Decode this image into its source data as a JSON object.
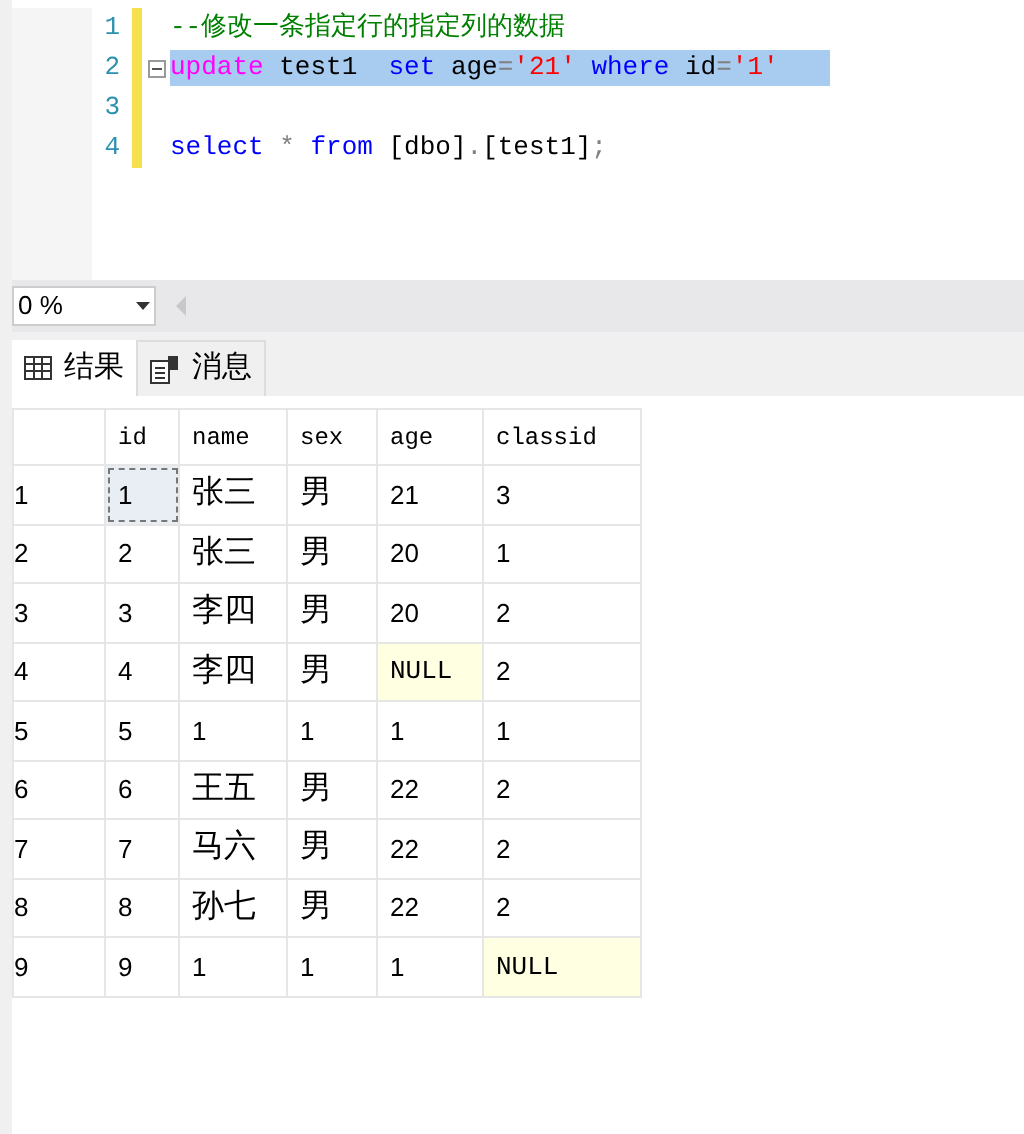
{
  "editor": {
    "lines": [
      {
        "number": "1",
        "selected": false,
        "fold": false,
        "tokens": [
          {
            "kind": "comment",
            "text": "--修改一条指定行的指定列的数据"
          }
        ]
      },
      {
        "number": "2",
        "selected": true,
        "fold": true,
        "tokens": [
          {
            "kind": "function",
            "text": "update"
          },
          {
            "kind": "plain",
            "text": " test1  "
          },
          {
            "kind": "keyword",
            "text": "set"
          },
          {
            "kind": "plain",
            "text": " age"
          },
          {
            "kind": "operator",
            "text": "="
          },
          {
            "kind": "string",
            "text": "'21'"
          },
          {
            "kind": "keyword",
            "text": " where"
          },
          {
            "kind": "plain",
            "text": " id"
          },
          {
            "kind": "operator",
            "text": "="
          },
          {
            "kind": "string",
            "text": "'1'"
          }
        ]
      },
      {
        "number": "3",
        "selected": false,
        "fold": false
      },
      {
        "number": "4",
        "selected": false,
        "fold": false,
        "tokens": [
          {
            "kind": "keyword",
            "text": "select"
          },
          {
            "kind": "operator",
            "text": " *"
          },
          {
            "kind": "keyword",
            "text": " from"
          },
          {
            "kind": "plain",
            "text": " [dbo]"
          },
          {
            "kind": "operator",
            "text": "."
          },
          {
            "kind": "plain",
            "text": "[test1]"
          },
          {
            "kind": "operator",
            "text": ";"
          }
        ]
      }
    ]
  },
  "zoom": {
    "value": "0 %"
  },
  "tabs": [
    {
      "label": "结果",
      "kind": "grid",
      "selected": true
    },
    {
      "label": "消息",
      "kind": "messages",
      "selected": false
    }
  ],
  "table": {
    "columns": [
      "id",
      "name",
      "sex",
      "age",
      "classid"
    ],
    "rows": [
      {
        "number": "1",
        "cells": [
          {
            "text": "1",
            "null": false,
            "focused": true
          },
          {
            "text": "张三",
            "null": false,
            "focused": false
          },
          {
            "text": "男",
            "null": false,
            "focused": false
          },
          {
            "text": "21",
            "null": false,
            "focused": false
          },
          {
            "text": "3",
            "null": false,
            "focused": false
          }
        ]
      },
      {
        "number": "2",
        "cells": [
          {
            "text": "2",
            "null": false,
            "focused": false
          },
          {
            "text": "张三",
            "null": false,
            "focused": false
          },
          {
            "text": "男",
            "null": false,
            "focused": false
          },
          {
            "text": "20",
            "null": false,
            "focused": false
          },
          {
            "text": "1",
            "null": false,
            "focused": false
          }
        ]
      },
      {
        "number": "3",
        "cells": [
          {
            "text": "3",
            "null": false,
            "focused": false
          },
          {
            "text": "李四",
            "null": false,
            "focused": false
          },
          {
            "text": "男",
            "null": false,
            "focused": false
          },
          {
            "text": "20",
            "null": false,
            "focused": false
          },
          {
            "text": "2",
            "null": false,
            "focused": false
          }
        ]
      },
      {
        "number": "4",
        "cells": [
          {
            "text": "4",
            "null": false,
            "focused": false
          },
          {
            "text": "李四",
            "null": false,
            "focused": false
          },
          {
            "text": "男",
            "null": false,
            "focused": false
          },
          {
            "text": "NULL",
            "null": true,
            "focused": false
          },
          {
            "text": "2",
            "null": false,
            "focused": false
          }
        ]
      },
      {
        "number": "5",
        "cells": [
          {
            "text": "5",
            "null": false,
            "focused": false
          },
          {
            "text": "1",
            "null": false,
            "focused": false
          },
          {
            "text": "1",
            "null": false,
            "focused": false
          },
          {
            "text": "1",
            "null": false,
            "focused": false
          },
          {
            "text": "1",
            "null": false,
            "focused": false
          }
        ]
      },
      {
        "number": "6",
        "cells": [
          {
            "text": "6",
            "null": false,
            "focused": false
          },
          {
            "text": "王五",
            "null": false,
            "focused": false
          },
          {
            "text": "男",
            "null": false,
            "focused": false
          },
          {
            "text": "22",
            "null": false,
            "focused": false
          },
          {
            "text": "2",
            "null": false,
            "focused": false
          }
        ]
      },
      {
        "number": "7",
        "cells": [
          {
            "text": "7",
            "null": false,
            "focused": false
          },
          {
            "text": "马六",
            "null": false,
            "focused": false
          },
          {
            "text": "男",
            "null": false,
            "focused": false
          },
          {
            "text": "22",
            "null": false,
            "focused": false
          },
          {
            "text": "2",
            "null": false,
            "focused": false
          }
        ]
      },
      {
        "number": "8",
        "cells": [
          {
            "text": "8",
            "null": false,
            "focused": false
          },
          {
            "text": "孙七",
            "null": false,
            "focused": false
          },
          {
            "text": "男",
            "null": false,
            "focused": false
          },
          {
            "text": "22",
            "null": false,
            "focused": false
          },
          {
            "text": "2",
            "null": false,
            "focused": false
          }
        ]
      },
      {
        "number": "9",
        "cells": [
          {
            "text": "9",
            "null": false,
            "focused": false
          },
          {
            "text": "1",
            "null": false,
            "focused": false
          },
          {
            "text": "1",
            "null": false,
            "focused": false
          },
          {
            "text": "1",
            "null": false,
            "focused": false
          },
          {
            "text": "NULL",
            "null": true,
            "focused": false
          }
        ]
      }
    ]
  }
}
